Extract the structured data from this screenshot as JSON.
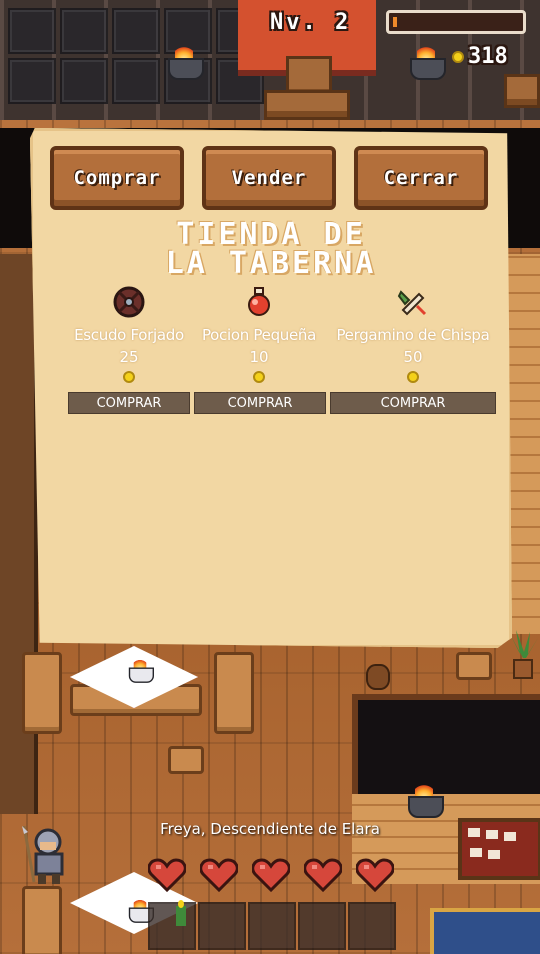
{
  "hud": {
    "level": "Nv. 2",
    "gold": "318",
    "xp_fraction": 0.03,
    "accent_color": "#f08a2a"
  },
  "shop": {
    "tabs": [
      {
        "label": "Comprar"
      },
      {
        "label": "Vender"
      },
      {
        "label": "Cerrar"
      }
    ],
    "title": "TIENDA DE\nLA TABERNA",
    "items": [
      {
        "name": "Escudo Forjado",
        "price": "25",
        "icon": "shield-icon",
        "buy_label": "COMPRAR"
      },
      {
        "name": "Pocion Pequeña",
        "price": "10",
        "icon": "potion-icon",
        "buy_label": "COMPRAR"
      },
      {
        "name": "Pergamino de Chispa",
        "price": "50",
        "icon": "scroll-icon",
        "buy_label": "COMPRAR"
      }
    ]
  },
  "player": {
    "name": "Freya, Descendiente de Elara",
    "hearts_full": 5,
    "hotbar_slots": 5
  }
}
